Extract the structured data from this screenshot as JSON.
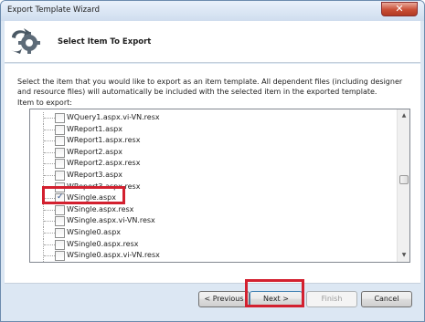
{
  "window": {
    "title": "Export Template Wizard",
    "close_glyph": "✕"
  },
  "header": {
    "title": "Select Item To Export",
    "icon": "wizard-gear-arrow-icon"
  },
  "content": {
    "description": "Select the item that you would like to export as an item template. All dependent files (including designer and resource files) will automatically be included with the selected item in the exported template.",
    "items_label": "Item to export:",
    "items": [
      {
        "label": "WQuery1.aspx.vi-VN.resx",
        "checked": false
      },
      {
        "label": "WReport1.aspx",
        "checked": false
      },
      {
        "label": "WReport1.aspx.resx",
        "checked": false
      },
      {
        "label": "WReport2.aspx",
        "checked": false
      },
      {
        "label": "WReport2.aspx.resx",
        "checked": false
      },
      {
        "label": "WReport3.aspx",
        "checked": false
      },
      {
        "label": "WReport3.aspx.resx",
        "checked": false
      },
      {
        "label": "WSingle.aspx",
        "checked": true
      },
      {
        "label": "WSingle.aspx.resx",
        "checked": false
      },
      {
        "label": "WSingle.aspx.vi-VN.resx",
        "checked": false
      },
      {
        "label": "WSingle0.aspx",
        "checked": false
      },
      {
        "label": "WSingle0.aspx.resx",
        "checked": false
      },
      {
        "label": "WSingle0.aspx.vi-VN.resx",
        "checked": false
      }
    ]
  },
  "footer": {
    "previous": "< Previous",
    "next": "Next >",
    "finish": "Finish",
    "cancel": "Cancel"
  },
  "colors": {
    "highlight": "#d3202f",
    "window_frame": "#dce7f3"
  }
}
